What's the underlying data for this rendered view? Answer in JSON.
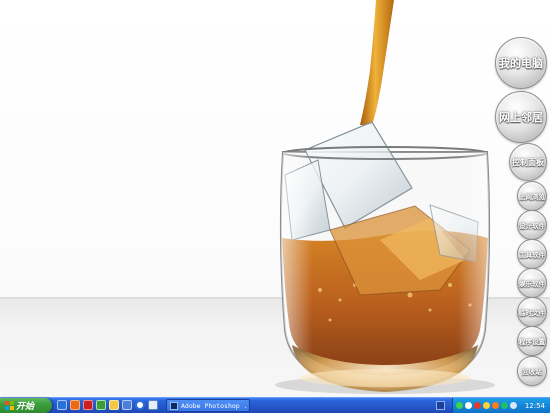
{
  "desktop": {
    "side_buttons": [
      {
        "label": "我的电脑",
        "icon": "my-computer-button"
      },
      {
        "label": "网上邻居",
        "icon": "network-places-button"
      },
      {
        "label": "控制面板",
        "icon": "control-panel-button"
      },
      {
        "label": "上网浏览",
        "icon": "web-browse-button"
      },
      {
        "label": "设计软件",
        "icon": "design-software-button"
      },
      {
        "label": "工具软件",
        "icon": "tool-software-button"
      },
      {
        "label": "娱乐软件",
        "icon": "entertainment-software-button"
      },
      {
        "label": "临时文件",
        "icon": "temp-files-button"
      },
      {
        "label": "程序设置",
        "icon": "program-settings-button"
      },
      {
        "label": "回收站",
        "icon": "recycle-bin-button"
      }
    ],
    "wallpaper": {
      "subject": "glass-of-whiskey-with-ice",
      "liquid_color": "#b5540d",
      "pour_color": "#d9901c"
    }
  },
  "taskbar": {
    "start_label": "开始",
    "quick_launch": [
      "ie-icon",
      "office-icon",
      "flash-icon",
      "dw-icon",
      "folder-icon",
      "show-desktop-icon",
      "media-icon",
      "explorer-icon"
    ],
    "task_button_label": "Adobe Photoshop ...",
    "clock": "12:54",
    "tray_icons": [
      "network-icon",
      "volume-icon",
      "security-icon",
      "update-icon",
      "antivirus-icon",
      "qq-icon",
      "shield-icon"
    ],
    "colors": {
      "taskbar_blue": "#2456c9",
      "start_green": "#3d9e3d",
      "tray_blue": "#1487d9"
    }
  }
}
